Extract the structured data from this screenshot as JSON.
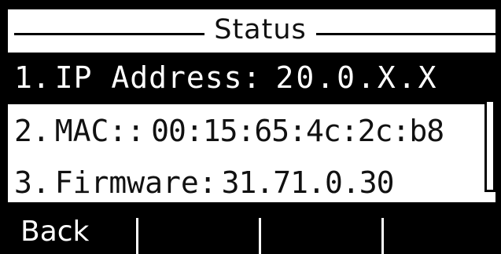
{
  "title": "Status",
  "menu": {
    "items": [
      {
        "number": "1.",
        "label": "IP Address:",
        "value": "20.0.X.X",
        "selected": true
      },
      {
        "number": "2.",
        "label": "MAC::",
        "value": "00:15:65:4c:2c:b8",
        "selected": false
      },
      {
        "number": "3.",
        "label": "Firmware:",
        "value": "31.71.0.30",
        "selected": false
      }
    ]
  },
  "softkeys": {
    "key1": "Back",
    "key2": "",
    "key3": "",
    "key4": ""
  },
  "colors": {
    "background": "#ffffff",
    "foreground": "#000000",
    "highlight_text": "#ffffff"
  }
}
